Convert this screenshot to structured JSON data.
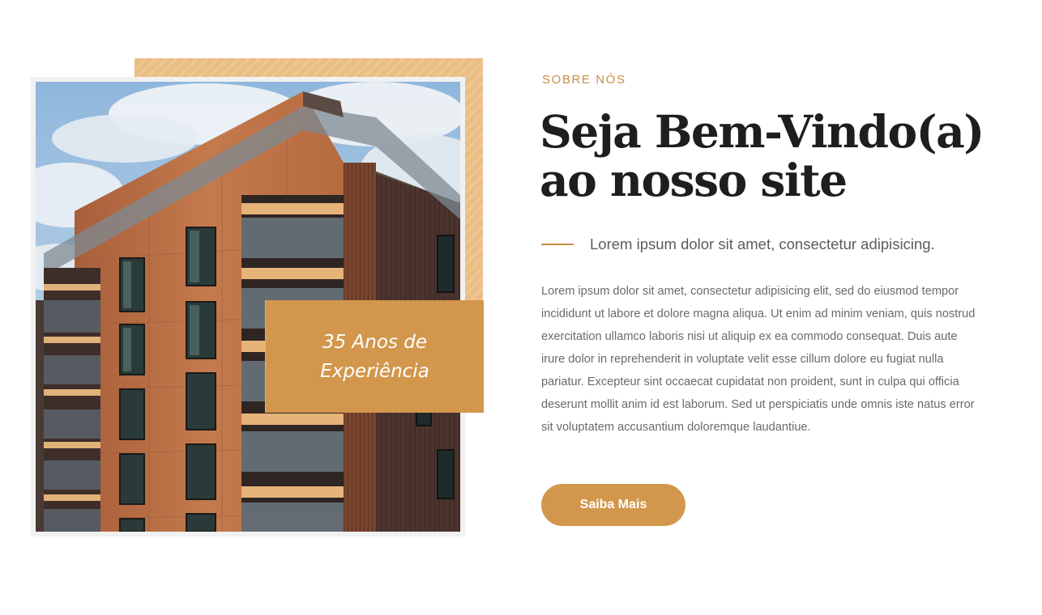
{
  "about": {
    "eyebrow": "SOBRE NÓS",
    "title_line1": "Seja Bem-Vindo(a)",
    "title_line2": "ao nosso site",
    "lead": "Lorem ipsum dolor sit amet, consectetur adipisicing.",
    "body": "Lorem ipsum dolor sit amet, consectetur adipisicing elit, sed do eiusmod tempor incididunt ut labore et dolore magna aliqua. Ut enim ad minim veniam, quis nostrud exercitation ullamco laboris nisi ut aliquip ex ea commodo consequat. Duis aute irure dolor in reprehenderit in voluptate velit esse cillum dolore eu fugiat nulla pariatur. Excepteur sint occaecat cupidatat non proident, sunt in culpa qui officia deserunt mollit anim id est laborum. Sed ut perspiciatis unde omnis iste natus error sit voluptatem accusantium doloremque laudantiue.",
    "button_label": "Saiba Mais"
  },
  "experience": {
    "line1": "35 Anos de",
    "line2": "Experiência"
  },
  "colors": {
    "accent": "#d2974d",
    "accent_light": "#ebbe84",
    "heading": "#1e1e1e",
    "body": "#6a6a6a"
  }
}
